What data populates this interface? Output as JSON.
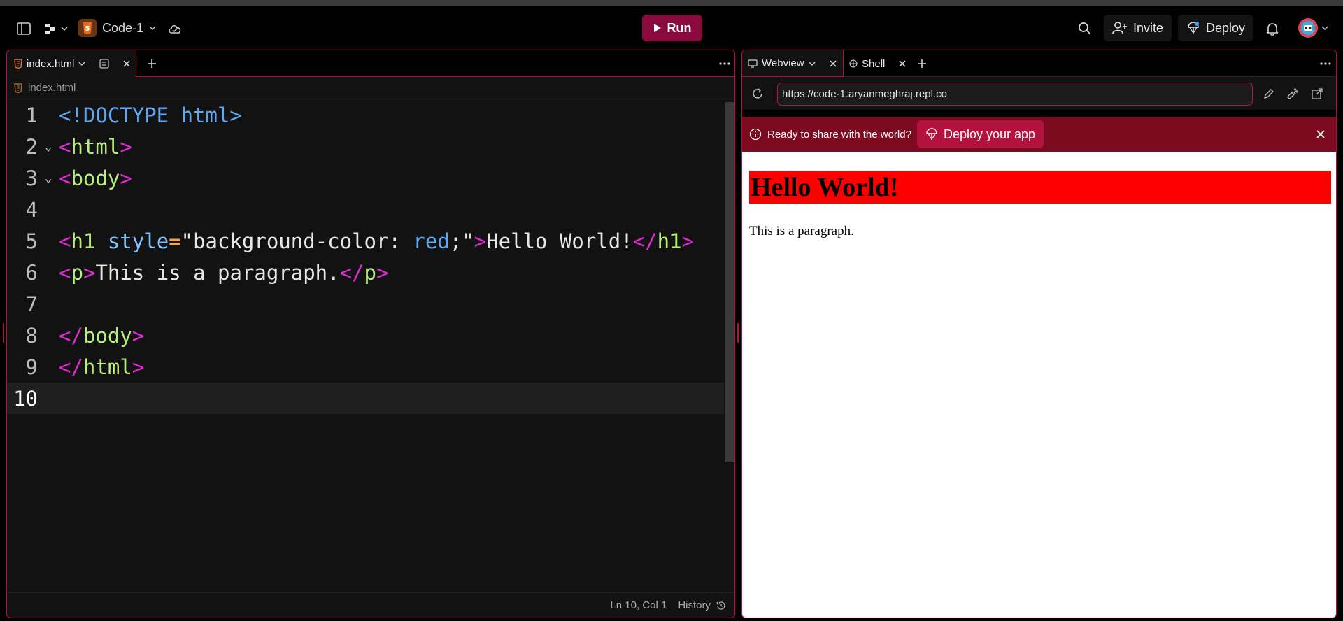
{
  "header": {
    "repl_name": "Code-1",
    "run_label": "Run",
    "invite_label": "Invite",
    "deploy_label": "Deploy"
  },
  "editor": {
    "tab_label": "index.html",
    "breadcrumb": "index.html",
    "lines": [
      {
        "n": "1"
      },
      {
        "n": "2"
      },
      {
        "n": "3"
      },
      {
        "n": "4"
      },
      {
        "n": "5"
      },
      {
        "n": "6"
      },
      {
        "n": "7"
      },
      {
        "n": "8"
      },
      {
        "n": "9"
      },
      {
        "n": "10"
      }
    ],
    "code": {
      "l1": "<!DOCTYPE html>",
      "l2_open": "<",
      "l2_tag": "html",
      "l2_close": ">",
      "l3_open": "<",
      "l3_tag": "body",
      "l3_close": ">",
      "l5_open": "<",
      "l5_tag": "h1",
      "l5_attr": " style",
      "l5_eq": "=",
      "l5_q1": "\"",
      "l5_prop": "background-color: ",
      "l5_val": "red",
      "l5_semi": ";",
      "l5_q2": "\"",
      "l5_gt": ">",
      "l5_text": "Hello World!",
      "l5_end_open": "</",
      "l5_end_tag": "h1",
      "l5_end_close": ">",
      "l6_open": "<",
      "l6_tag": "p",
      "l6_gt": ">",
      "l6_text": "This is a paragraph.",
      "l6_end_open": "</",
      "l6_end_tag": "p",
      "l6_end_close": ">",
      "l8_open": "</",
      "l8_tag": "body",
      "l8_close": ">",
      "l9_open": "</",
      "l9_tag": "html",
      "l9_close": ">"
    },
    "status": {
      "cursor": "Ln 10, Col 1",
      "history_label": "History"
    }
  },
  "webview": {
    "tab_webview": "Webview",
    "tab_shell": "Shell",
    "url": "https://code-1.aryanmeghraj.repl.co",
    "banner_text": "Ready to share with the world?",
    "deploy_app_label": "Deploy your app",
    "page": {
      "heading": "Hello World!",
      "paragraph": "This is a paragraph."
    }
  },
  "colors": {
    "accent": "#b3123e",
    "run_button": "#8b0a3d",
    "banner": "#7d0b1f",
    "heading_bg": "#ff0000"
  }
}
